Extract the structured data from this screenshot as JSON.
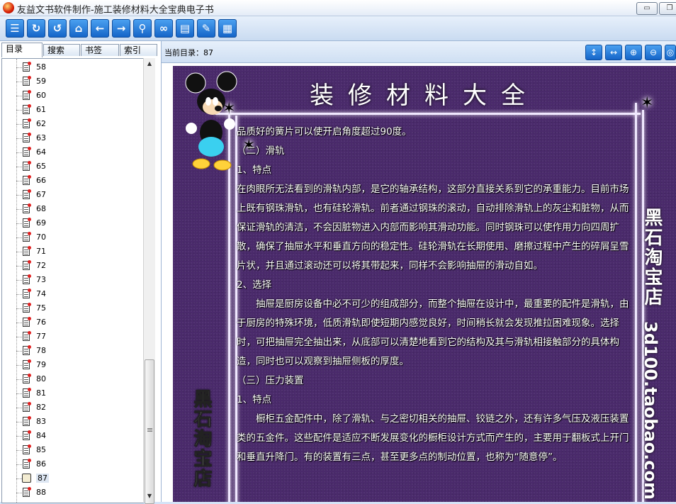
{
  "window": {
    "title": "友益文书软件制作-施工装修材料大全宝典电子书",
    "min_label": "▭",
    "restore_label": "❐"
  },
  "toolbar": {
    "buttons": [
      {
        "name": "toc-icon",
        "glyph": "☰"
      },
      {
        "name": "refresh-icon",
        "glyph": "↻"
      },
      {
        "name": "undo-icon",
        "glyph": "↺"
      },
      {
        "name": "home-icon",
        "glyph": "⌂"
      },
      {
        "name": "back-icon",
        "glyph": "←"
      },
      {
        "name": "forward-icon",
        "glyph": "→"
      },
      {
        "name": "search-icon",
        "glyph": "⚲"
      },
      {
        "name": "link-icon",
        "glyph": "∞"
      },
      {
        "name": "note-icon",
        "glyph": "▤"
      },
      {
        "name": "edit-icon",
        "glyph": "✎"
      },
      {
        "name": "bookmark-icon",
        "glyph": "▦"
      }
    ]
  },
  "sidebar": {
    "tabs": [
      "目录",
      "搜索",
      "书签",
      "索引"
    ],
    "items": [
      "58",
      "59",
      "60",
      "61",
      "62",
      "63",
      "64",
      "65",
      "66",
      "67",
      "68",
      "69",
      "70",
      "71",
      "72",
      "73",
      "74",
      "75",
      "76",
      "77",
      "78",
      "79",
      "80",
      "81",
      "82",
      "83",
      "84",
      "85",
      "86",
      "87",
      "88"
    ],
    "selected": "87"
  },
  "reader_header": {
    "current_label": "当前目录：",
    "current_value": "87",
    "buttons": [
      {
        "name": "fit-height-icon",
        "glyph": "↕"
      },
      {
        "name": "fit-width-icon",
        "glyph": "↔"
      },
      {
        "name": "zoom-in-icon",
        "glyph": "⊕"
      },
      {
        "name": "zoom-out-icon",
        "glyph": "⊖"
      },
      {
        "name": "zoom-reset-icon",
        "glyph": "◎"
      }
    ]
  },
  "page": {
    "title": "装修材料大全",
    "brand_vertical": "黑石淘宝店",
    "brand_url": "3d100.taobao.com",
    "paragraphs": [
      {
        "text": "品质好的簧片可以使开启角度超过90度。",
        "indent": false
      },
      {
        "text": "（二）滑轨",
        "indent": false
      },
      {
        "text": "1、特点",
        "indent": false
      },
      {
        "text": "在肉眼所无法看到的滑轨内部，是它的轴承结构，这部分直接关系到它的承重能力。目前市场上既有钢珠滑轨，也有硅轮滑轨。前者通过钢珠的滚动，自动排除滑轨上的灰尘和脏物，从而保证滑轨的清洁，不会因脏物进入内部而影响其滑动功能。同时钢珠可以使作用力向四周扩散，确保了抽屉水平和垂直方向的稳定性。硅轮滑轨在长期使用、磨擦过程中产生的碎屑呈雪片状，并且通过滚动还可以将其带起来，同样不会影响抽屉的滑动自如。",
        "indent": false
      },
      {
        "text": "2、选择",
        "indent": false
      },
      {
        "text": "抽屉是厨房设备中必不可少的组成部分，而整个抽屉在设计中，最重要的配件是滑轨，由于厨房的特殊环境，低质滑轨即使短期内感觉良好，时间稍长就会发现推拉困难现象。选择时，可把抽屉完全抽出来，从底部可以清楚地看到它的结构及其与滑轨相接触部分的具体构造，同时也可以观察到抽屉侧板的厚度。",
        "indent": true
      },
      {
        "text": "（三）压力装置",
        "indent": false
      },
      {
        "text": "1、特点",
        "indent": false
      },
      {
        "text": "橱柜五金配件中，除了滑轨、与之密切相关的抽屉、铰链之外，还有许多气压及液压装置类的五金件。这些配件是适应不断发展变化的橱柜设计方式而产生的，主要用于翻板式上开门和垂直升降门。有的装置有三点，甚至更多点的制动位置，也称为“随意停”。",
        "indent": true
      }
    ]
  }
}
